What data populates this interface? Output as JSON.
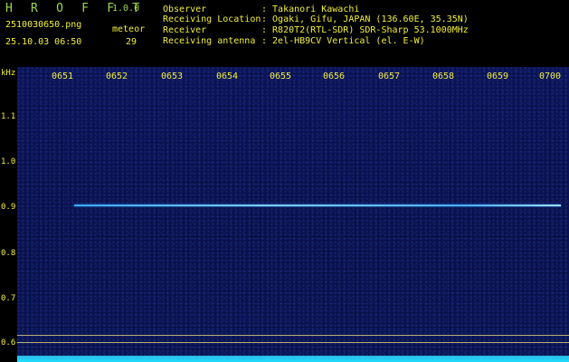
{
  "header": {
    "app_title": "H R O F F T",
    "app_version": "1.0.0",
    "file_name": "2510030650.png",
    "date_time": "25.10.03 06:50",
    "meteor_label": "meteor",
    "meteor_count": "29",
    "info": [
      {
        "label": "Observer",
        "value": ": Takanori Kawachi"
      },
      {
        "label": "Receiving Location",
        "value": ": Ogaki, Gifu, JAPAN (136.60E, 35.35N)"
      },
      {
        "label": "Receiver",
        "value": ": R820T2(RTL-SDR) SDR-Sharp 53.1000MHz"
      },
      {
        "label": "Receiving antenna",
        "value": ": 2el-HB9CV Vertical (el. E-W)"
      }
    ]
  },
  "spectrogram": {
    "unit": "kHz",
    "time_ticks": [
      "0651",
      "0652",
      "0653",
      "0654",
      "0655",
      "0656",
      "0657",
      "0658",
      "0659",
      "0700"
    ],
    "freq_ticks": [
      "1.1",
      "1.0",
      "0.9",
      "0.8",
      "0.7",
      "0.6"
    ],
    "signal_frequency_khz": 0.9
  },
  "colors": {
    "header_green": "#9fd64a",
    "header_yellow": "#f2ef3a",
    "background": "#0a1250",
    "signal": "#7fd0ff"
  }
}
